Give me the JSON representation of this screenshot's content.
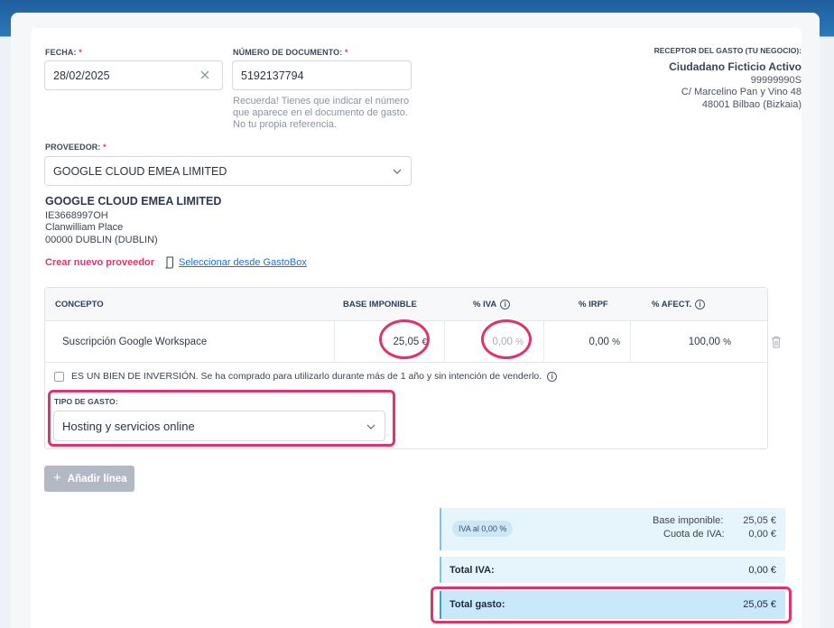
{
  "form": {
    "fecha_label": "FECHA:",
    "fecha_value": "28/02/2025",
    "numero_label": "NÚMERO DE DOCUMENTO:",
    "numero_value": "5192137794",
    "numero_hint_1": "Recuerda! Tienes que indicar el número",
    "numero_hint_2": "que aparece en el documento de gasto.",
    "numero_hint_3": "No tu propia referencia.",
    "required_mark": "*",
    "proveedor_label": "PROVEEDOR:",
    "proveedor_value": "GOOGLE CLOUD EMEA LIMITED"
  },
  "receptor": {
    "label": "RECEPTOR DEL GASTO (TU NEGOCIO):",
    "name": "Ciudadano Ficticio Activo",
    "nif": "99999990S",
    "address1": "C/ Marcelino Pan y Vino 48",
    "address2": "48001 Bilbao (Bizkaia)"
  },
  "provider": {
    "name": "GOOGLE CLOUD EMEA LIMITED",
    "vat": "IE3668997OH",
    "address1": "Clanwilliam Place",
    "address2": "00000 DUBLIN (DUBLIN)",
    "create_link": "Crear nuevo proveedor",
    "select_link": "Seleccionar desde GastoBox"
  },
  "table": {
    "headers": {
      "concepto": "CONCEPTO",
      "base": "BASE IMPONIBLE",
      "iva": "% IVA",
      "irpf": "% IRPF",
      "afect": "% AFECT."
    },
    "row": {
      "concepto": "Suscripción Google Workspace",
      "base": "25,05",
      "base_unit": "€",
      "iva": "0,00",
      "iva_unit": "%",
      "irpf": "0,00",
      "irpf_unit": "%",
      "afect": "100,00",
      "afect_unit": "%"
    },
    "inversion_text": "ES UN BIEN DE INVERSIÓN. Se ha comprado para utilizarlo durante más de 1 año y sin intención de venderlo.",
    "tipo_label": "TIPO DE GASTO:",
    "tipo_value": "Hosting y servicios online"
  },
  "actions": {
    "add_line": "Añadir línea"
  },
  "summary": {
    "iva_badge": "IVA al 0,00 %",
    "base_label": "Base imponible:",
    "base_value": "25,05 €",
    "cuota_label": "Cuota de IVA:",
    "cuota_value": "0,00 €",
    "total_iva_label": "Total IVA:",
    "total_iva_value": "0,00 €",
    "total_gasto_label": "Total gasto:",
    "total_gasto_value": "25,05 €"
  },
  "icons": {
    "info": "i",
    "plus": "+"
  },
  "colors": {
    "accent_pink": "#e0336d",
    "link_blue": "#1f6fd1",
    "summary_bg": "#e6f4fc",
    "total_bg": "#c9e8fa"
  }
}
